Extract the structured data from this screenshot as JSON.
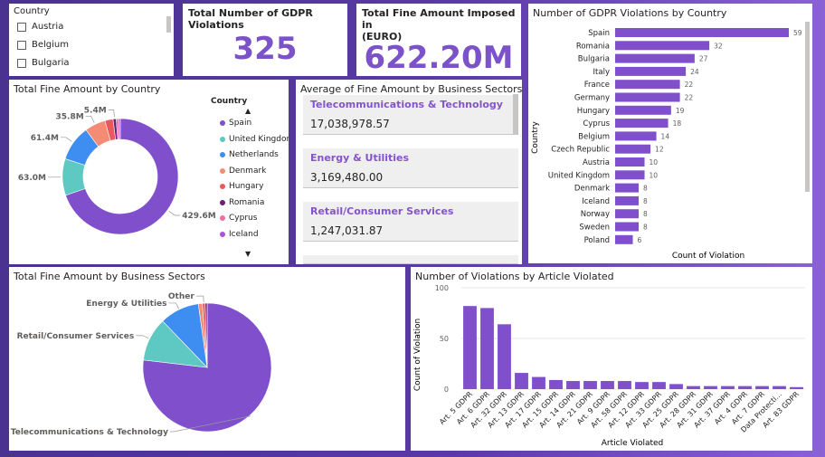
{
  "slicer": {
    "title": "Country",
    "items": [
      {
        "label": "Austria"
      },
      {
        "label": "Belgium"
      },
      {
        "label": "Bulgaria"
      }
    ]
  },
  "kpi_violations": {
    "title": "Total Number of GDPR Violations",
    "value": "325"
  },
  "kpi_fines": {
    "title_line1": "Total Fine Amount Imposed in",
    "title_line2": "(EURO)",
    "value": "622.20M"
  },
  "avg_sectors": {
    "title": "Average of Fine Amount by Business Sectors",
    "items": [
      {
        "label": "Telecommunications & Technology",
        "value": "17,038,978.57"
      },
      {
        "label": "Energy & Utilities",
        "value": "3,169,480.00"
      },
      {
        "label": "Retail/Consumer Services",
        "value": "1,247,031.87"
      }
    ]
  },
  "colors": {
    "purple": "#7f4fcc",
    "teal": "#5ec9c2",
    "blue": "#3d8ef0",
    "salmon": "#f48b74",
    "red": "#e8585d",
    "darkpurple": "#6b1f7a",
    "pink": "#ef6fa0",
    "violet": "#b04fd8"
  },
  "chart_data": [
    {
      "type": "pie",
      "variant": "donut",
      "title": "Total Fine Amount by Country",
      "legend_title": "Country",
      "legend_position": "right",
      "legend": [
        "Spain",
        "United Kingdom",
        "Netherlands",
        "Denmark",
        "Hungary",
        "Romania",
        "Cyprus",
        "Iceland"
      ],
      "slices": [
        {
          "value": 429.6,
          "label": "429.6M",
          "color": "#7f4fcc"
        },
        {
          "value": 63.0,
          "label": "63.0M",
          "color": "#5ec9c2"
        },
        {
          "value": 61.4,
          "label": "61.4M",
          "color": "#3d8ef0"
        },
        {
          "value": 35.8,
          "label": "35.8M",
          "color": "#f48b74"
        },
        {
          "value": 14.0,
          "label": "",
          "color": "#e8585d"
        },
        {
          "value": 5.4,
          "label": "5.4M",
          "color": "#6b1f7a"
        },
        {
          "value": 4.0,
          "label": "",
          "color": "#ef6fa0"
        },
        {
          "value": 3.0,
          "label": "",
          "color": "#b04fd8"
        }
      ]
    },
    {
      "type": "bar",
      "orientation": "horizontal",
      "title": "Number of GDPR Violations by Country",
      "xlabel": "Count of Violation",
      "ylabel": "Country",
      "categories": [
        "Spain",
        "Romania",
        "Bulgaria",
        "Italy",
        "France",
        "Germany",
        "Hungary",
        "Cyprus",
        "Belgium",
        "Czech Republic",
        "Austria",
        "United Kingdom",
        "Denmark",
        "Iceland",
        "Norway",
        "Sweden",
        "Poland"
      ],
      "values": [
        59,
        32,
        27,
        24,
        22,
        22,
        19,
        18,
        14,
        12,
        10,
        10,
        8,
        8,
        8,
        8,
        6
      ]
    },
    {
      "type": "pie",
      "title": "Total Fine Amount by Business Sectors",
      "slices": [
        {
          "label": "Telecommunications & Technology",
          "value": 77,
          "color": "#7f4fcc"
        },
        {
          "label": "Retail/Consumer Services",
          "value": 11,
          "color": "#5ec9c2"
        },
        {
          "label": "Energy & Utilities",
          "value": 10,
          "color": "#3d8ef0"
        },
        {
          "label": "",
          "value": 1,
          "color": "#f48b74"
        },
        {
          "label": "Other",
          "value": 0.7,
          "color": "#e8585d"
        },
        {
          "label": "",
          "value": 0.5,
          "color": "#6b1f7a"
        }
      ]
    },
    {
      "type": "bar",
      "title": "Number of Violations by Article Violated",
      "xlabel": "Article Violated",
      "ylabel": "Count of Violation",
      "ylim": [
        0,
        100
      ],
      "yticks": [
        "0",
        "50",
        "100"
      ],
      "categories": [
        "Art. 5 GDPR",
        "Art. 6 GDPR",
        "Art. 32 GDPR",
        "Art. 13 GDPR",
        "Art. 17 GDPR",
        "Art. 15 GDPR",
        "Art. 14 GDPR",
        "Art. 21 GDPR",
        "Art. 9 GDPR",
        "Art. 58 GDPR",
        "Art. 12 GDPR",
        "Art. 33 GDPR",
        "Art. 25 GDPR",
        "Art. 28 GDPR",
        "Art. 31 GDPR",
        "Art. 37 GDPR",
        "Art. 4 GDPR",
        "Art. 7 GDPR",
        "Data Protecti...",
        "Art. 83 GDPR"
      ],
      "values": [
        82,
        80,
        64,
        16,
        12,
        9,
        8,
        8,
        8,
        8,
        7,
        7,
        5,
        3,
        3,
        3,
        3,
        3,
        3,
        2
      ]
    }
  ]
}
